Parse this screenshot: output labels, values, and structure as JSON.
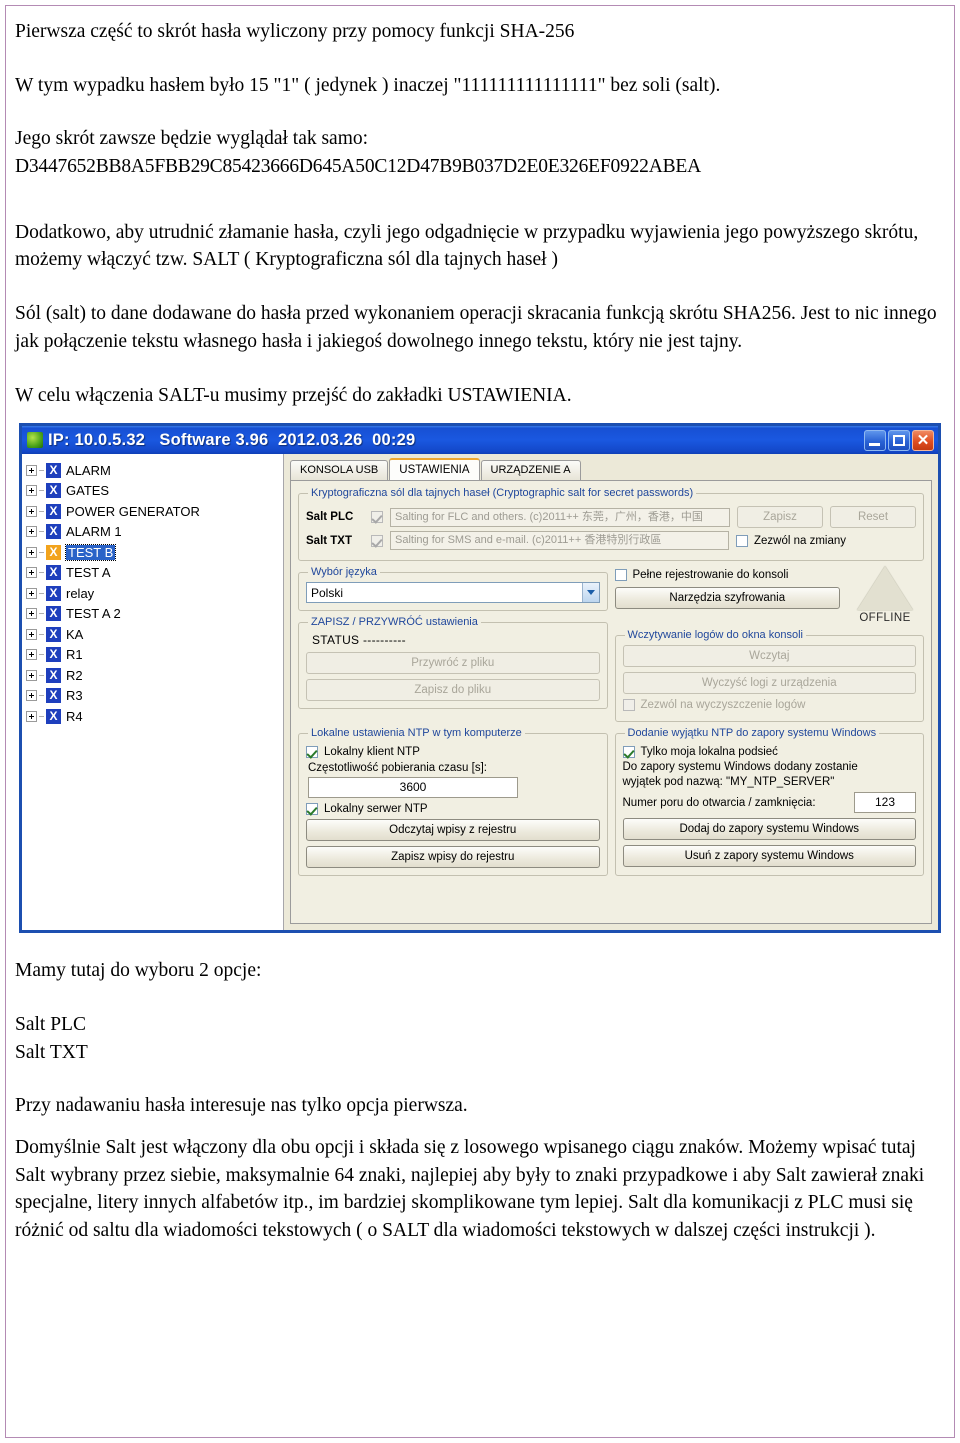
{
  "document": {
    "paragraphs": [
      "Pierwsza część to skrót hasła wyliczony przy pomocy funkcji SHA-256",
      "W tym wypadku hasłem było 15 \"1\" ( jedynek ) inaczej \"111111111111111\" bez soli (salt).",
      "Jego skrót zawsze będzie wyglądał tak samo:",
      "D3447652BB8A5FBB29C85423666D645A50C12D47B9B037D2E0E326EF0922ABEA",
      "Dodatkowo, aby utrudnić złamanie hasła, czyli jego odgadnięcie w przypadku wyjawienia jego powyższego skrótu, możemy włączyć tzw. SALT (  Kryptograficzna sól dla tajnych haseł )",
      "Sól (salt) to dane dodawane do hasła przed wykonaniem operacji skracania funkcją skrótu SHA256. Jest to nic innego jak połączenie tekstu własnego hasła i jakiegoś dowolnego innego tekstu, który nie jest tajny.",
      "W celu włączenia SALT-u musimy przejść do zakładki USTAWIENIA."
    ],
    "after_image": [
      "Mamy tutaj do wyboru 2 opcje:",
      "Salt PLC",
      "Salt TXT",
      "Przy nadawaniu hasła interesuje nas tylko opcja pierwsza.",
      "Domyślnie Salt jest włączony dla obu opcji i składa się z losowego wpisanego ciągu znaków. Możemy wpisać tutaj Salt wybrany przez siebie, maksymalnie 64 znaki, najlepiej aby były to znaki przypadkowe i aby Salt zawierał znaki specjalne, litery innych alfabetów itp., im bardziej skomplikowane tym lepiej. Salt dla komunikacji z PLC musi się różnić od saltu dla wiadomości tekstowych ( o SALT dla wiadomości tekstowych w dalszej części instrukcji )."
    ]
  },
  "app": {
    "titlebar": {
      "title": "IP: 10.0.5.32   Software 3.96  2012.03.26  00:29",
      "minimize": "",
      "maximize": "",
      "close": "✕"
    },
    "tree": {
      "items": [
        {
          "label": "ALARM",
          "marker_color": "#1e3fbd",
          "selected": false
        },
        {
          "label": "GATES",
          "marker_color": "#1e3fbd",
          "selected": false
        },
        {
          "label": "POWER GENERATOR",
          "marker_color": "#1e3fbd",
          "selected": false
        },
        {
          "label": "ALARM 1",
          "marker_color": "#1e3fbd",
          "selected": false
        },
        {
          "label": "TEST B",
          "marker_color": "#f2a31c",
          "selected": true
        },
        {
          "label": "TEST A",
          "marker_color": "#1e3fbd",
          "selected": false
        },
        {
          "label": "relay",
          "marker_color": "#1e3fbd",
          "selected": false
        },
        {
          "label": "TEST A 2",
          "marker_color": "#1e3fbd",
          "selected": false
        },
        {
          "label": "KA",
          "marker_color": "#1e3fbd",
          "selected": false
        },
        {
          "label": "R1",
          "marker_color": "#1e3fbd",
          "selected": false
        },
        {
          "label": "R2",
          "marker_color": "#1e3fbd",
          "selected": false
        },
        {
          "label": "R3",
          "marker_color": "#1e3fbd",
          "selected": false
        },
        {
          "label": "R4",
          "marker_color": "#1e3fbd",
          "selected": false
        }
      ],
      "marker_glyph": "X"
    },
    "tabs": [
      {
        "label": "KONSOLA USB",
        "active": false
      },
      {
        "label": "USTAWIENIA",
        "active": true
      },
      {
        "label": "URZĄDZENIE A",
        "active": false
      }
    ],
    "salt_group": {
      "legend": "Kryptograficzna sól dla tajnych haseł (Cryptographic salt for secret passwords)",
      "rows": [
        {
          "label": "Salt PLC",
          "value": "Salting for FLC and others. (c)2011++ 东莞，广州，香港，中国"
        },
        {
          "label": "Salt TXT",
          "value": "Salting for SMS and e-mail. (c)2011++ 香港特別行政區"
        }
      ],
      "save_button": "Zapisz",
      "reset_button": "Reset",
      "allow_changes_label": "Zezwól na zmiany"
    },
    "language_group": {
      "legend": "Wybór  języka",
      "selected": "Polski"
    },
    "save_restore_group": {
      "legend": "ZAPISZ / PRZYWRÓĆ ustawienia",
      "status": "STATUS ----------",
      "restore_button": "Przywróć z pliku",
      "save_button": "Zapisz do pliku"
    },
    "console_group": {
      "full_logging_label": "Pełne rejestrowanie do konsoli",
      "crypto_tools_button": "Narzędzia szyfrowania",
      "status_indicator": "OFFLINE",
      "logs_legend": "Wczytywanie logów do okna konsoli",
      "load_button": "Wczytaj",
      "clear_button": "Wyczyść logi z urządzenia",
      "allow_clear_label": "Zezwól na wyczyszczenie logów"
    },
    "ntp_group": {
      "legend": "Lokalne ustawienia NTP w tym komputerze",
      "client_label": "Lokalny klient NTP",
      "interval_label": "Częstotliwość pobierania czasu [s]:",
      "interval_value": "3600",
      "server_label": "Lokalny serwer NTP",
      "read_registry_button": "Odczytaj wpisy z rejestru",
      "write_registry_button": "Zapisz wpisy do rejestru"
    },
    "firewall_group": {
      "legend": "Dodanie wyjątku NTP do zapory systemu Windows",
      "subnet_label": "Tylko moja lokalna podsieć",
      "note_line1": "Do zapory systemu Windows dodany zostanie",
      "note_line2": "wyjątek pod nazwą: \"MY_NTP_SERVER\"",
      "port_label": "Numer poru do otwarcia / zamknięcia:",
      "port_value": "123",
      "add_button": "Dodaj do zapory systemu Windows",
      "remove_button": "Usuń z zapory systemu Windows"
    }
  },
  "colors": {
    "page_border": "#b48bb4",
    "titlebar_blue": "#1750d4",
    "window_border": "#1c4fb0",
    "accent_orange": "#f0a830",
    "legend_blue": "#21489c"
  }
}
